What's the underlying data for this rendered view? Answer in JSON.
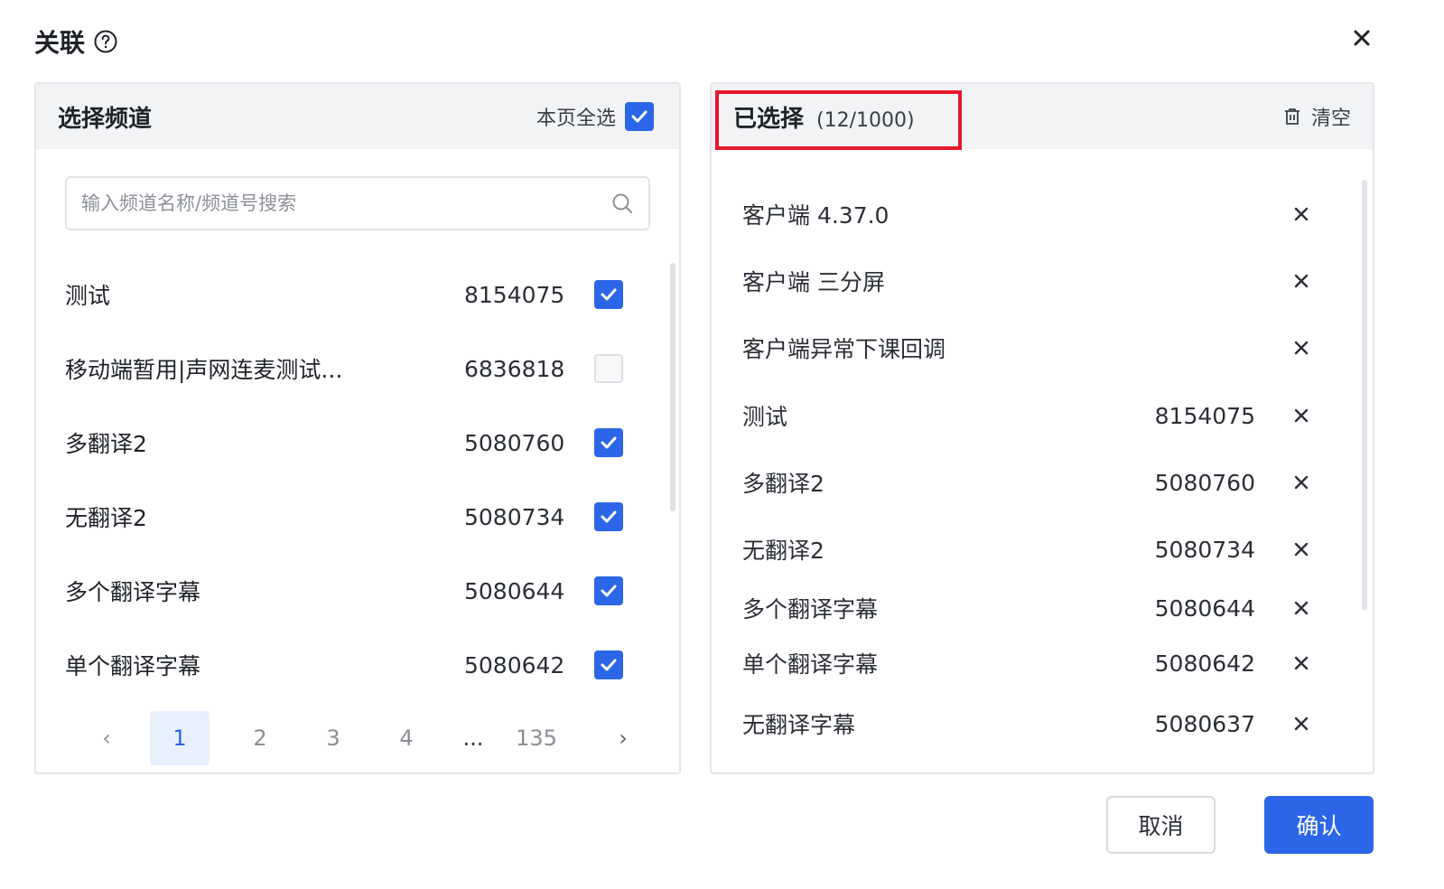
{
  "dialog": {
    "title": "关联",
    "help_icon": "help-circle-icon",
    "close_icon": "close-icon"
  },
  "left_panel": {
    "title": "选择频道",
    "select_all_label": "本页全选",
    "select_all_checked": true,
    "search_placeholder": "输入频道名称/频道号搜索",
    "search_value": "",
    "channels": [
      {
        "name": "测试",
        "number": "8154075",
        "checked": true
      },
      {
        "name": "移动端暂用|声网连麦测试...",
        "number": "6836818",
        "checked": false
      },
      {
        "name": "多翻译2",
        "number": "5080760",
        "checked": true
      },
      {
        "name": "无翻译2",
        "number": "5080734",
        "checked": true
      },
      {
        "name": "多个翻译字幕",
        "number": "5080644",
        "checked": true
      },
      {
        "name": "单个翻译字幕",
        "number": "5080642",
        "checked": true
      }
    ],
    "pagination": {
      "prev": "‹",
      "pages": [
        "1",
        "2",
        "3",
        "4",
        "...",
        "135"
      ],
      "current": "1",
      "next": "›"
    }
  },
  "right_panel": {
    "title": "已选择",
    "count": "(12/1000)",
    "clear_label": "清空",
    "selected": [
      {
        "name": "客户端 4.37.0",
        "number": ""
      },
      {
        "name": "客户端 三分屏",
        "number": ""
      },
      {
        "name": "客户端异常下课回调",
        "number": ""
      },
      {
        "name": "测试",
        "number": "8154075"
      },
      {
        "name": "多翻译2",
        "number": "5080760"
      },
      {
        "name": "无翻译2",
        "number": "5080734"
      },
      {
        "name": "多个翻译字幕",
        "number": "5080644"
      },
      {
        "name": "单个翻译字幕",
        "number": "5080642"
      },
      {
        "name": "无翻译字幕",
        "number": "5080637"
      }
    ]
  },
  "footer": {
    "cancel_label": "取消",
    "confirm_label": "确认"
  },
  "colors": {
    "primary": "#2c66e8",
    "highlight": "#e8172c",
    "header_bg": "#f2f3f5"
  }
}
